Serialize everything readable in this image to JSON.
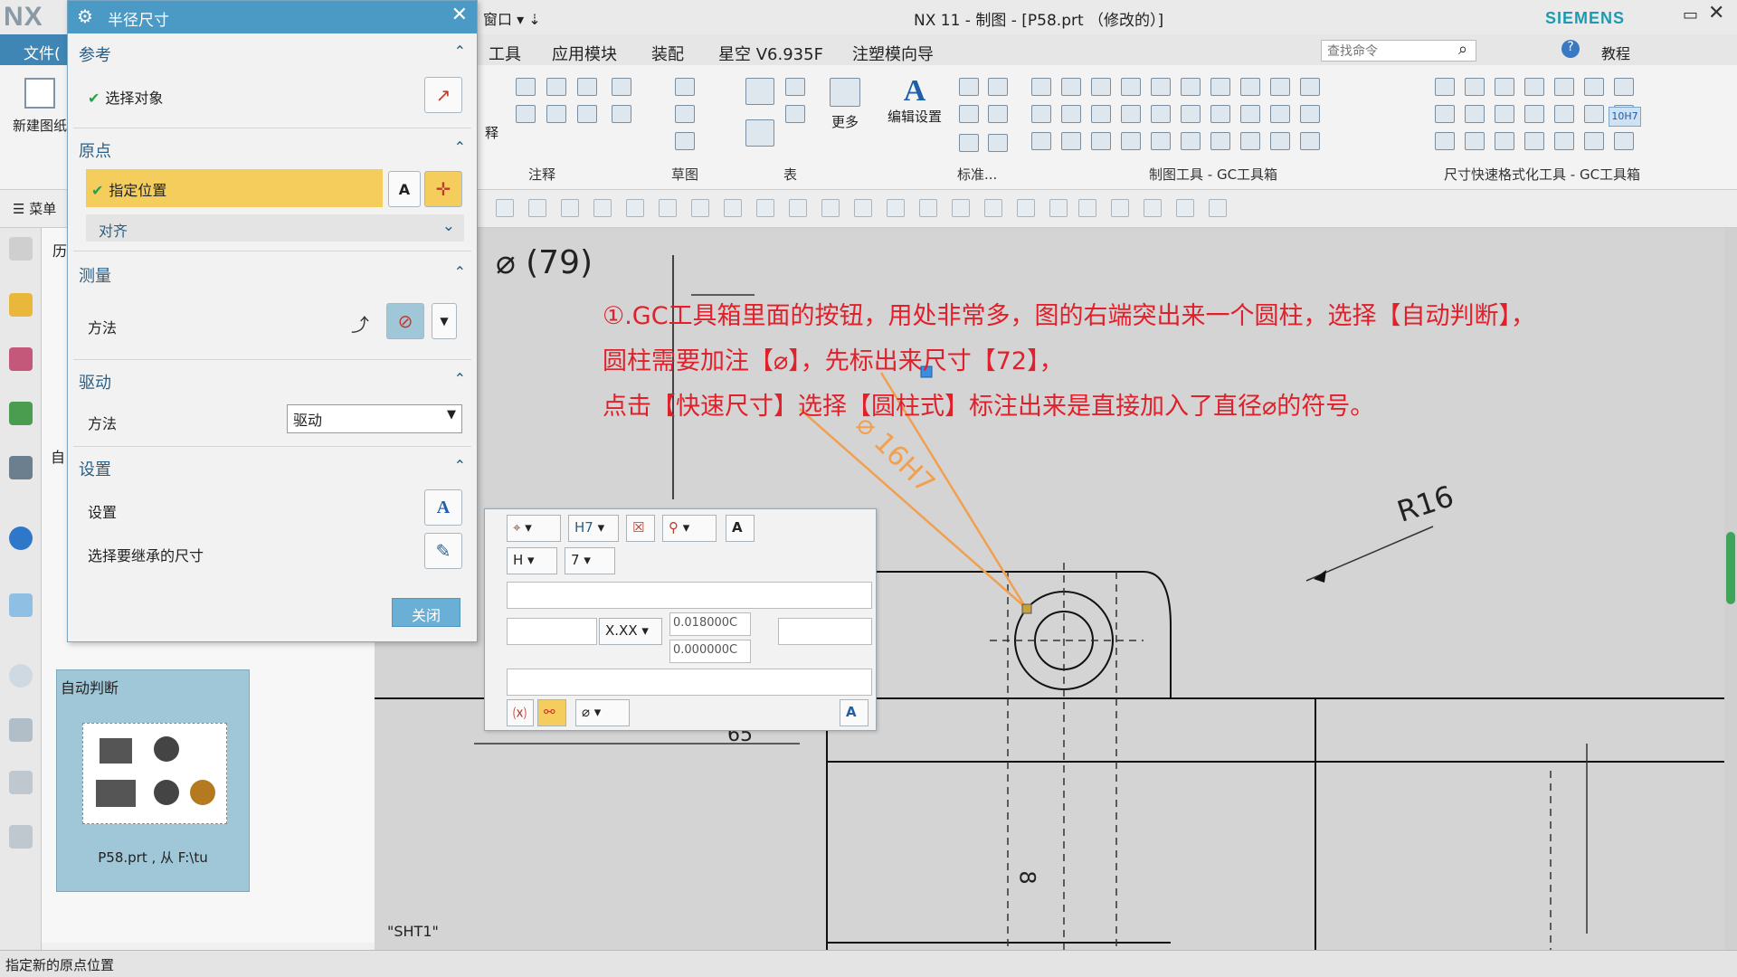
{
  "window": {
    "logo": "NX",
    "quick_window": "窗口 ▾ ⇣",
    "title": "NX 11 - 制图 - [P58.prt （修改的）]",
    "brand": "SIEMENS",
    "controls": [
      "▭",
      "▭",
      "✕"
    ]
  },
  "menubar": {
    "file": "文件(",
    "items": [
      "工具",
      "应用模块",
      "装配",
      "星空 V6.935F",
      "注塑模向导"
    ],
    "search_placeholder": "查找命令",
    "help_label": "教程"
  },
  "ribbon": {
    "new_sheet": "新建图纸",
    "menu_label": "菜单",
    "annotation_small": "释",
    "sections": [
      "注释",
      "草图",
      "表",
      "标准...",
      "制图工具 - GC工具箱",
      "尺寸快速格式化工具 - GC工具箱"
    ],
    "more": "更多",
    "edit_settings": "编辑设置",
    "tolerance_badge": "10H7"
  },
  "dialog": {
    "title": "半径尺寸",
    "groups": {
      "reference": {
        "title": "参考",
        "select_object": "选择对象"
      },
      "origin": {
        "title": "原点",
        "specify_location": "指定位置",
        "align": "对齐"
      },
      "measure": {
        "title": "测量",
        "method_label": "方法"
      },
      "drive": {
        "title": "驱动",
        "method_label": "方法",
        "method_value": "驱动"
      },
      "settings": {
        "title": "设置",
        "settings_label": "设置",
        "inherit_label": "选择要继承的尺寸"
      }
    },
    "close": "关闭"
  },
  "navigator": {
    "preview_title": "自动判断",
    "preview_caption": "P58.prt , 从 F:\\tu",
    "partial_labels": [
      "历",
      "自"
    ]
  },
  "dimension_popup": {
    "tolerance_class": "H7",
    "fit_letter": "H",
    "fit_number": "7",
    "precision": "X.XX",
    "upper_tol": "0.018000C",
    "lower_tol": "0.000000C",
    "prefix_symbol": "⌀"
  },
  "drawing": {
    "top_dim": "⌀ (79)",
    "callout_dim": "⌀ 16H7",
    "radius_dim": "R16",
    "bottom_dim": "65",
    "side_dim": "8",
    "sheet": "\"SHT1\"",
    "annotation_lines": [
      "①.GC工具箱里面的按钮，用处非常多，图的右端突出来一个圆柱，选择【自动判断】，",
      "圆柱需要加注【⌀】，先标出来尺寸【72】，",
      "点击【快速尺寸】选择【圆柱式】标注出来是直接加入了直径⌀的符号。"
    ]
  },
  "status": {
    "text": "指定新的原点位置"
  },
  "colors": {
    "accent_blue": "#4b9ac6",
    "highlight_yellow": "#f4cd5c",
    "annotation_red": "#e0202a",
    "leader_orange": "#f0a050",
    "canvas_gray": "#d4d4d4"
  }
}
